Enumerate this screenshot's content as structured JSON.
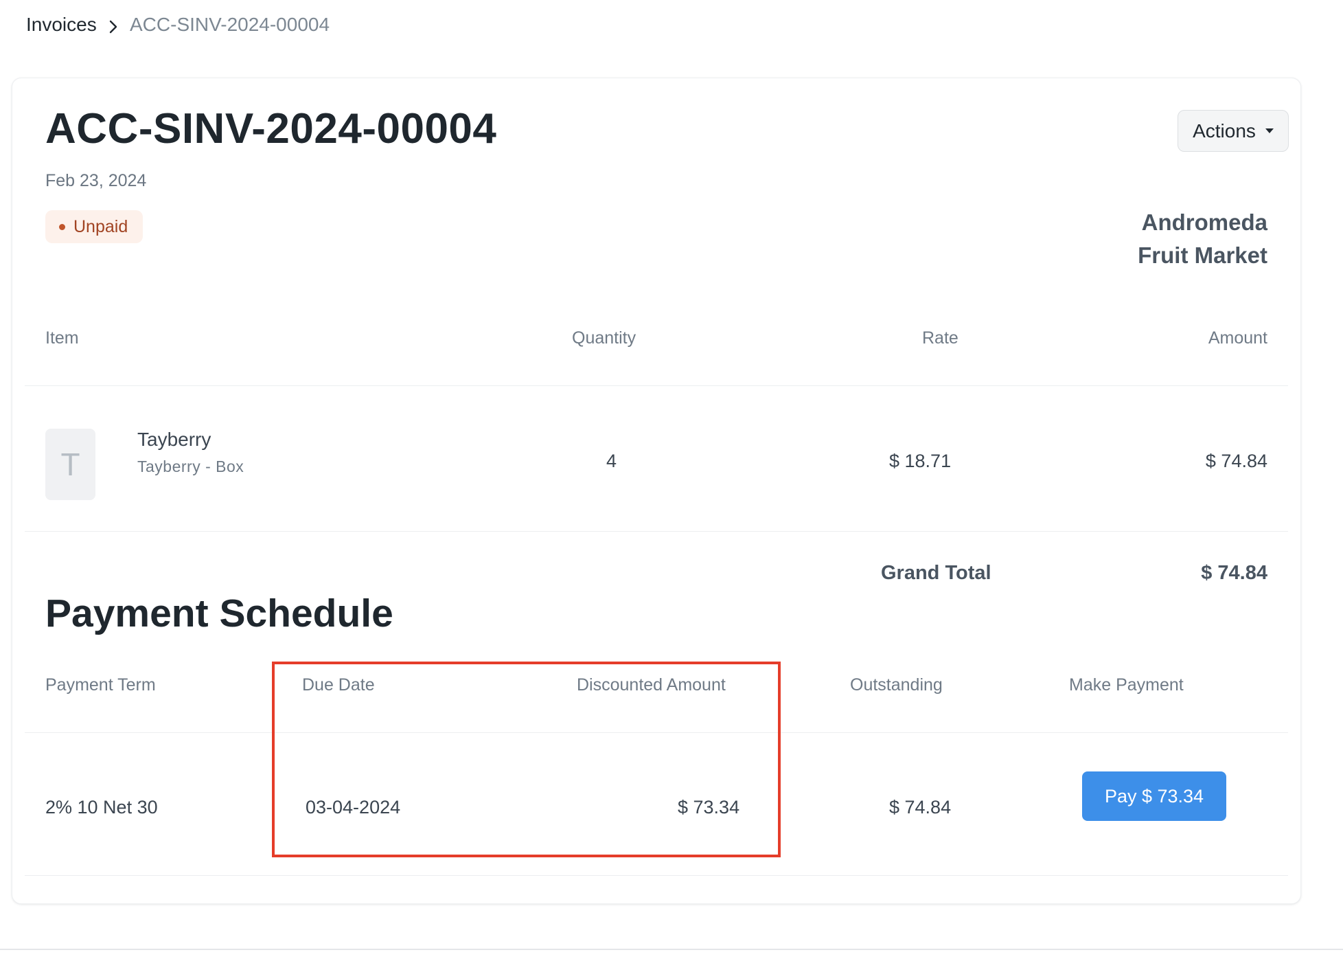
{
  "breadcrumb": {
    "root": "Invoices",
    "current": "ACC-SINV-2024-00004"
  },
  "invoice": {
    "number": "ACC-SINV-2024-00004",
    "date": "Feb 23, 2024",
    "status": "Unpaid",
    "actions_label": "Actions",
    "company_line1": "Andromeda",
    "company_line2": "Fruit Market"
  },
  "items_table": {
    "headers": [
      "Item",
      "Quantity",
      "Rate",
      "Amount"
    ],
    "rows": [
      {
        "thumb_letter": "T",
        "name": "Tayberry",
        "description": "Tayberry - Box",
        "quantity": "4",
        "rate": "$ 18.71",
        "amount": "$ 74.84"
      }
    ],
    "grand_total_label": "Grand Total",
    "grand_total_value": "$ 74.84"
  },
  "payment_schedule": {
    "title": "Payment Schedule",
    "headers": [
      "Payment Term",
      "Due Date",
      "Discounted Amount",
      "Outstanding",
      "Make Payment"
    ],
    "rows": [
      {
        "term": "2% 10 Net 30",
        "due_date": "03-04-2024",
        "discounted_amount": "$ 73.34",
        "outstanding": "$ 74.84",
        "pay_label": "Pay $ 73.34"
      }
    ]
  },
  "colors": {
    "accent": "#3d8fe9",
    "status_unpaid_bg": "#fdf1eb",
    "status_unpaid_text": "#a14423",
    "highlight": "#e53d2a"
  }
}
